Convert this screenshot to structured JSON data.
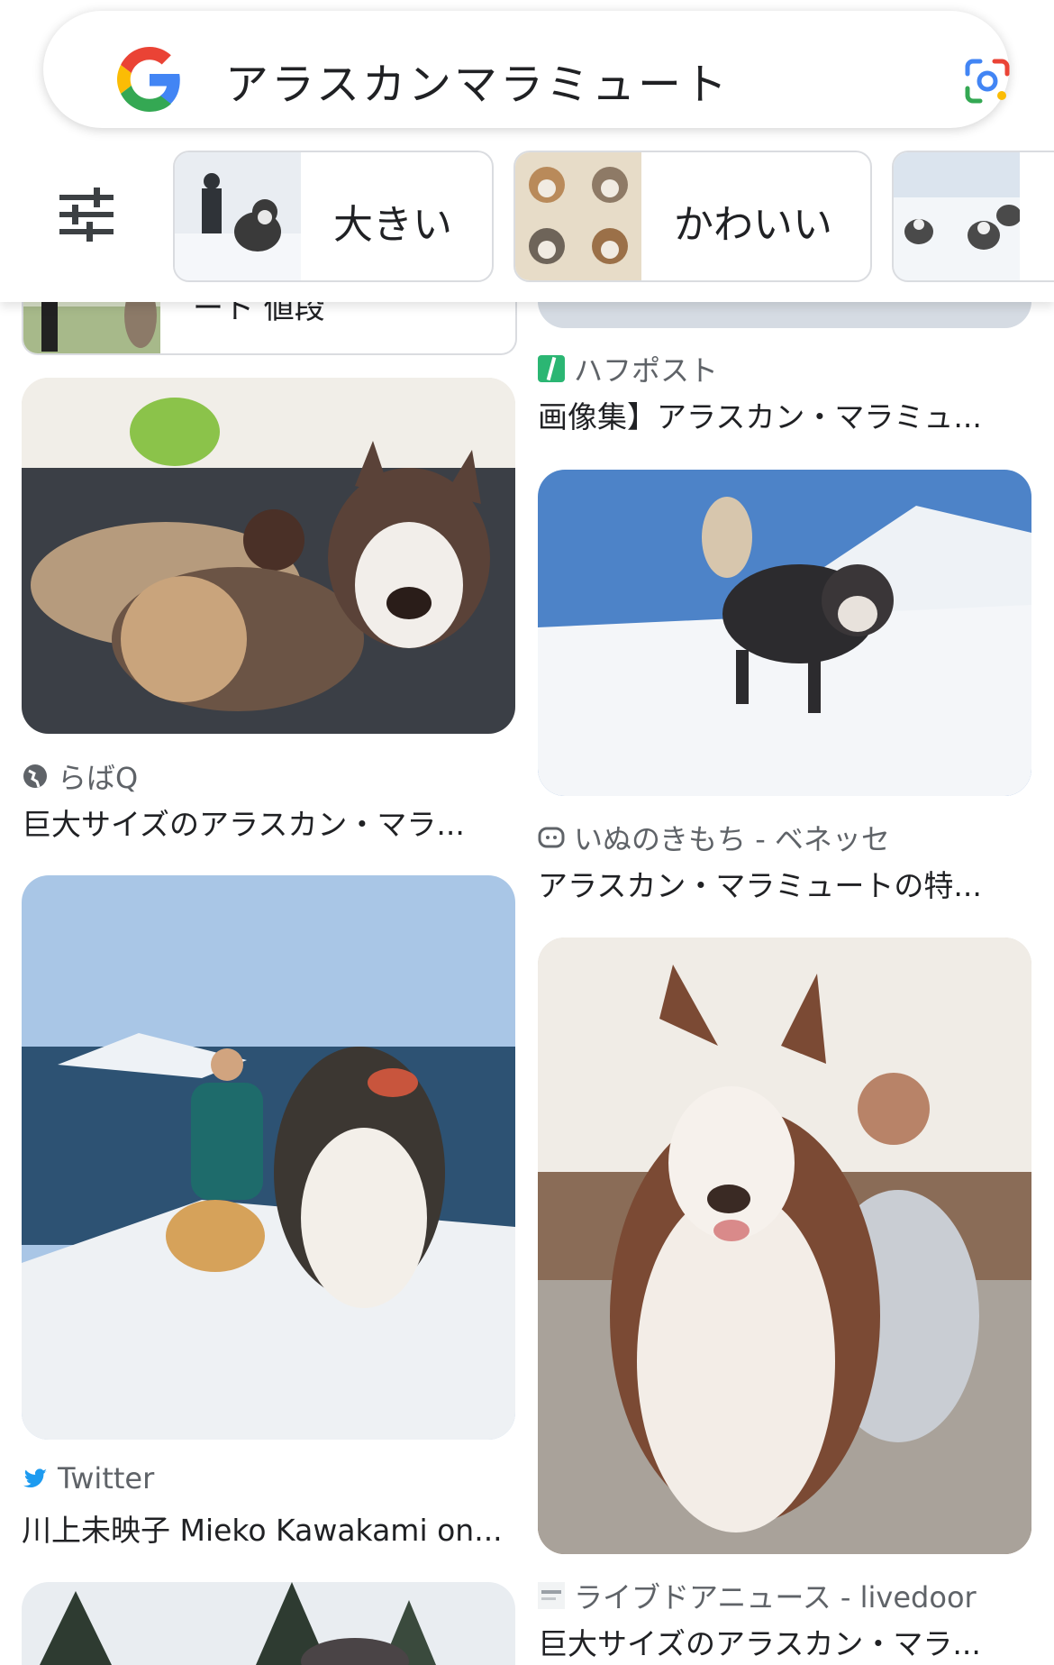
{
  "search": {
    "query": "アラスカンマラミュート"
  },
  "chips": [
    {
      "label": "大きい"
    },
    {
      "label": "かわいい"
    },
    {
      "label": ""
    }
  ],
  "partial": {
    "left_title": "ート 値段"
  },
  "results": [
    {
      "source": "ハフポスト",
      "title": "画像集】アラスカン・マラミュ..."
    },
    {
      "source": "らばQ",
      "title": "巨大サイズのアラスカン・マラ..."
    },
    {
      "source": "いぬのきもち - ベネッセ",
      "title": "アラスカン・マラミュートの特..."
    },
    {
      "source": "Twitter",
      "title": "川上未映子 Mieko Kawakami on..."
    },
    {
      "source": "ライブドアニュース - livedoor",
      "title": "巨大サイズのアラスカン・マラ..."
    }
  ],
  "colors": {
    "accent_blue": "#4285f4",
    "red": "#ea4335",
    "yellow": "#fbbc05",
    "green": "#34a853",
    "twitter": "#1d9bf0",
    "huffpost": "#2bb673"
  }
}
